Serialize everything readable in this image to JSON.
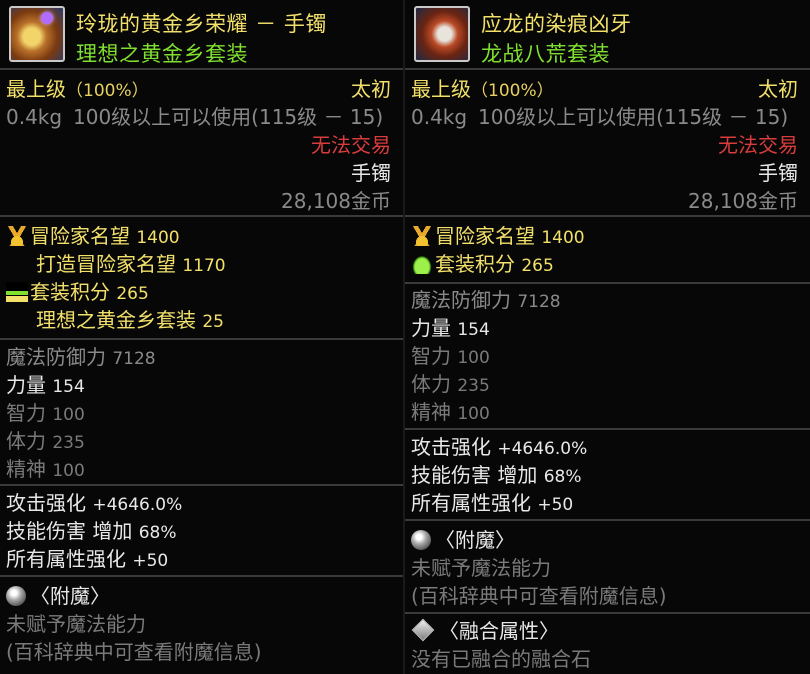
{
  "left": {
    "title": "玲珑的黄金乡荣耀 － 手镯",
    "set_name": "理想之黄金乡套装",
    "grade": "最上级",
    "grade_pct": "（100%）",
    "tier": "太初",
    "weight": "0.4kg",
    "level_req": "100级以上可以使用(115级 － 15)",
    "trade": "无法交易",
    "slot": "手镯",
    "price": "28,108金币",
    "fame_label": "冒险家名望",
    "fame_value": "1400",
    "forge_fame_label": "打造冒险家名望",
    "forge_fame_value": "1170",
    "set_points_label": "套装积分",
    "set_points_value": "265",
    "set_points_sub_label": "理想之黄金乡套装",
    "set_points_sub_value": "25",
    "mdef_label": "魔法防御力",
    "mdef_value": "7128",
    "str_label": "力量",
    "str_value": "154",
    "int_label": "智力",
    "int_value": "100",
    "vit_label": "体力",
    "vit_value": "235",
    "spr_label": "精神",
    "spr_value": "100",
    "atk_label": "攻击强化",
    "atk_value": "+4646.0%",
    "skill_label": "技能伤害 增加",
    "skill_value": "68%",
    "elem_label": "所有属性强化",
    "elem_value": "+50",
    "enchant_header": "〈附魔〉",
    "enchant_none": "未赋予魔法能力",
    "enchant_hint": "(百科辞典中可查看附魔信息)"
  },
  "right": {
    "title": "应龙的染痕凶牙",
    "set_name": "龙战八荒套装",
    "grade": "最上级",
    "grade_pct": "（100%）",
    "tier": "太初",
    "weight": "0.4kg",
    "level_req": "100级以上可以使用(115级 － 15)",
    "trade": "无法交易",
    "slot": "手镯",
    "price": "28,108金币",
    "fame_label": "冒险家名望",
    "fame_value": "1400",
    "set_points_label": "套装积分",
    "set_points_value": "265",
    "mdef_label": "魔法防御力",
    "mdef_value": "7128",
    "str_label": "力量",
    "str_value": "154",
    "int_label": "智力",
    "int_value": "100",
    "vit_label": "体力",
    "vit_value": "235",
    "spr_label": "精神",
    "spr_value": "100",
    "atk_label": "攻击强化",
    "atk_value": "+4646.0%",
    "skill_label": "技能伤害 增加",
    "skill_value": "68%",
    "elem_label": "所有属性强化",
    "elem_value": "+50",
    "enchant_header": "〈附魔〉",
    "enchant_none": "未赋予魔法能力",
    "enchant_hint": "(百科辞典中可查看附魔信息)",
    "fusion_header": "〈融合属性〉",
    "fusion_none": "没有已融合的融合石"
  }
}
